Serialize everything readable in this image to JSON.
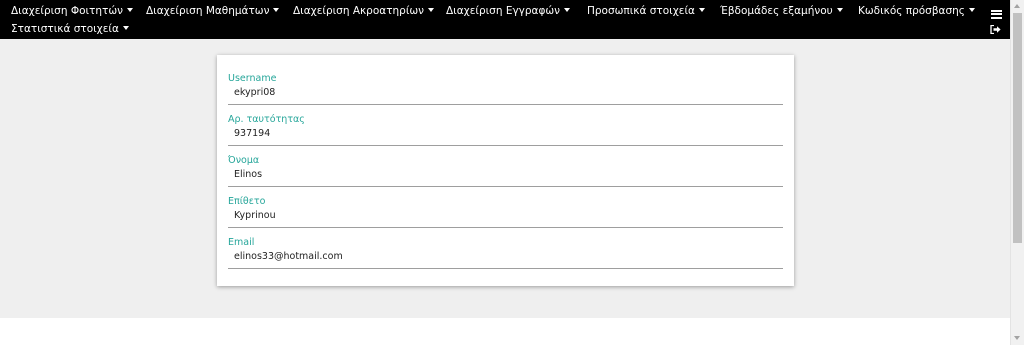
{
  "nav": {
    "items": [
      {
        "label": "Διαχείριση Φοιτητών"
      },
      {
        "label": "Διαχείριση Μαθημάτων"
      },
      {
        "label": "Διαχείριση Ακροατηρίων"
      },
      {
        "label": "Διαχείριση Εγγραφών"
      },
      {
        "label": "Προσωπικά στοιχεία"
      },
      {
        "label": "Έβδομάδες εξαμήνου"
      },
      {
        "label": "Κωδικός πρόσβασης"
      },
      {
        "label": "Στατιστικά στοιχεία"
      }
    ],
    "menu_icon": "hamburger-menu-icon",
    "logout_icon": "sign-out-icon"
  },
  "profile": {
    "fields": [
      {
        "label": "Username",
        "value": "ekypri08"
      },
      {
        "label": "Αρ. ταυτότητας",
        "value": "937194"
      },
      {
        "label": "Όνομα",
        "value": "Elinos"
      },
      {
        "label": "Επίθετο",
        "value": "Kyprinou"
      },
      {
        "label": "Email",
        "value": "elinos33@hotmail.com"
      }
    ]
  },
  "colors": {
    "navbar_bg": "#000000",
    "label_accent": "#26a69a",
    "page_bg": "#efefef"
  }
}
